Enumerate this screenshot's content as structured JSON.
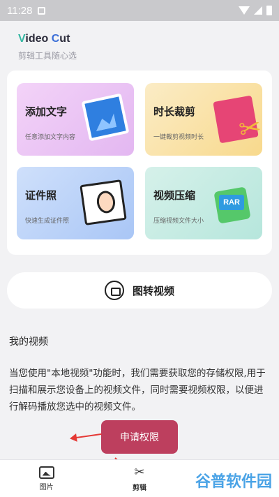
{
  "status_bar": {
    "time": "11:28"
  },
  "brand": {
    "title_v": "V",
    "title_mid": "ideo ",
    "title_c": "C",
    "title_end": "ut",
    "subtitle": "剪辑工具随心选"
  },
  "tools": [
    {
      "title": "添加文字",
      "subtitle": "任意添加文字内容",
      "icon": "image-text-icon"
    },
    {
      "title": "时长裁剪",
      "subtitle": "一键裁剪视频时长",
      "icon": "scissors-icon"
    },
    {
      "title": "证件照",
      "subtitle": "快速生成证件照",
      "icon": "id-photo-icon"
    },
    {
      "title": "视频压缩",
      "subtitle": "压缩视频文件大小",
      "icon": "rar-archive-icon",
      "badge": "RAR"
    }
  ],
  "convert": {
    "label": "图转视频"
  },
  "my_videos": {
    "title": "我的视频",
    "notice": "当您使用\"本地视频\"功能时，我们需要获取您的存储权限,用于扫描和展示您设备上的视频文件，同时需要视频权限，以便进行解码播放您选中的视频文件。"
  },
  "request_button": {
    "label": "申请权限"
  },
  "bottom_nav": [
    {
      "label": "图片",
      "icon": "picture-icon"
    },
    {
      "label": "剪辑",
      "icon": "scissors-icon",
      "active": true
    }
  ],
  "watermark": "谷普软件园",
  "colors": {
    "accent": "#bd3f5e",
    "arrow": "#e53935"
  }
}
